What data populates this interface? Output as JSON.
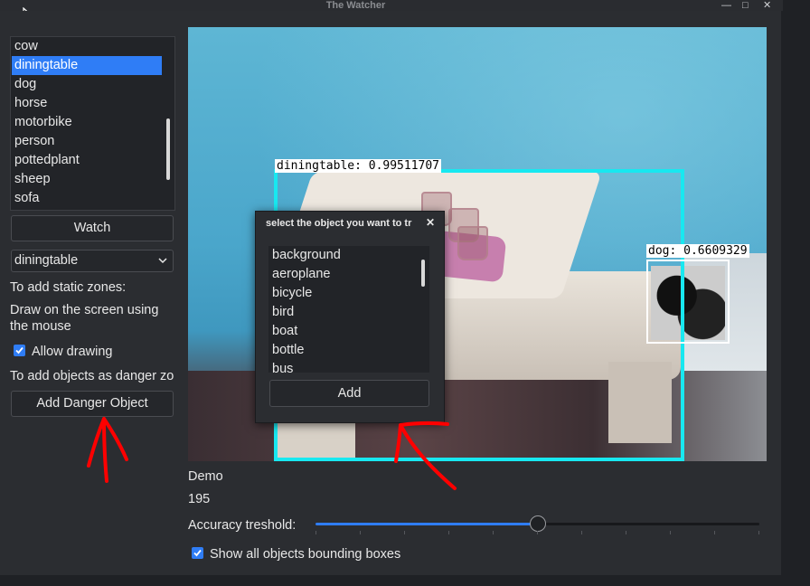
{
  "window": {
    "title": "The Watcher",
    "minimize_glyph": "—",
    "maximize_glyph": "□",
    "close_glyph": "✕"
  },
  "class_list": {
    "items": [
      "cow",
      "diningtable",
      "dog",
      "horse",
      "motorbike",
      "person",
      "pottedplant",
      "sheep",
      "sofa"
    ],
    "selected": "diningtable"
  },
  "watch_button": "Watch",
  "target_combo": {
    "selected": "diningtable"
  },
  "static_zones": {
    "heading": "To add static zones:",
    "instructions_line1": "Draw on the screen using",
    "instructions_line2": "the mouse"
  },
  "allow_drawing": {
    "label": "Allow drawing",
    "checked": true
  },
  "danger_objects": {
    "heading": "To add objects as danger zo",
    "button": "Add Danger Object"
  },
  "detections": [
    {
      "label": "diningtable: 0.99511707",
      "color": "#18e8f0"
    },
    {
      "label": "dog: 0.6609329",
      "color": "#ffffff"
    }
  ],
  "dialog": {
    "title": "select the object you want to tr",
    "close_glyph": "✕",
    "items": [
      "background",
      "aeroplane",
      "bicycle",
      "bird",
      "boat",
      "bottle",
      "bus"
    ],
    "add_button": "Add"
  },
  "status": {
    "source": "Demo",
    "frame_count": "195"
  },
  "accuracy": {
    "label": "Accuracy treshold:",
    "value_percent": 50
  },
  "show_boxes": {
    "label": "Show all objects bounding boxes",
    "checked": true
  },
  "colors": {
    "accent": "#2f7df6",
    "annotation": "#ff0000"
  }
}
